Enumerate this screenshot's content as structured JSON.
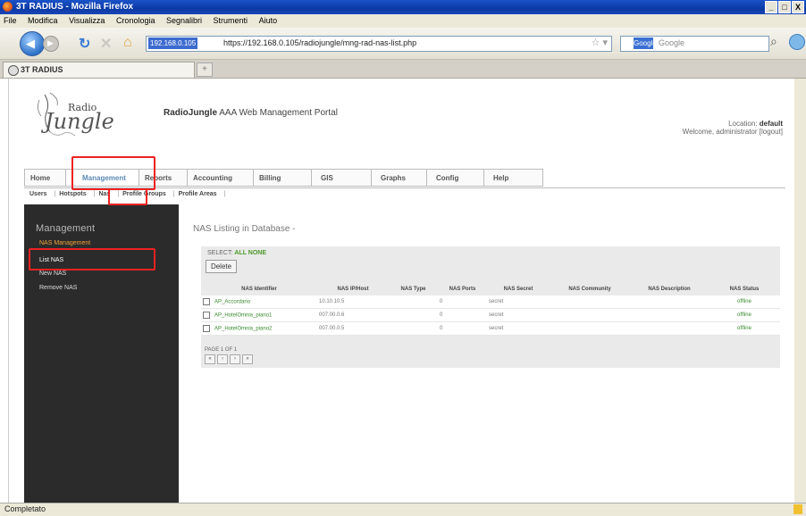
{
  "window": {
    "title": "3T RADIUS - Mozilla Firefox",
    "controls": [
      "_",
      "□",
      "X"
    ]
  },
  "menubar": [
    "File",
    "Modifica",
    "Visualizza",
    "Cronologia",
    "Segnalibri",
    "Strumenti",
    "Aiuto"
  ],
  "navbar": {
    "site_badge": "192.168.0.105",
    "url": "https://192.168.0.105/radiojungle/mng-rad-nas-list.php",
    "search_engine": "Google",
    "search_placeholder": "Google"
  },
  "tab": {
    "title": "3T RADIUS"
  },
  "header": {
    "brand": "RadioJungle",
    "portal": "AAA Web Management Portal",
    "logo_text_top": "Radio",
    "logo_text_bottom": "Jungle",
    "location_label": "Location:",
    "location_value": "default",
    "welcome": "Welcome, administrator [logout]"
  },
  "main_tabs": [
    {
      "label": "Home",
      "active": false
    },
    {
      "label": "Management",
      "active": true
    },
    {
      "label": "Reports",
      "active": false
    },
    {
      "label": "Accounting",
      "active": false
    },
    {
      "label": "Billing",
      "active": false
    },
    {
      "label": "GIS",
      "active": false
    },
    {
      "label": "Graphs",
      "active": false
    },
    {
      "label": "Config",
      "active": false
    },
    {
      "label": "Help",
      "active": false
    }
  ],
  "sub_tabs": [
    "Users",
    "Hotspots",
    "Nas",
    "Profile Groups",
    "Profile Areas"
  ],
  "sidebar": {
    "heading": "Management",
    "section": "NAS Management",
    "items": [
      "List NAS",
      "New NAS",
      "Remove NAS"
    ]
  },
  "content": {
    "title": "NAS Listing in Database -",
    "select_label": "SELECT:",
    "select_value": "ALL NONE",
    "delete_button": "Delete",
    "columns": [
      "NAS Identifier",
      "NAS IP/Host",
      "NAS Type",
      "NAS Ports",
      "NAS Secret",
      "NAS Community",
      "NAS Description",
      "NAS Status"
    ],
    "rows": [
      [
        "AP_Accordano",
        "10.10.10.5",
        "",
        "0",
        "secret",
        "",
        "",
        "offline"
      ],
      [
        "AP_HotelOmnia_piano1",
        "007.00.0.6",
        "",
        "0",
        "secret",
        "",
        "",
        "offline"
      ],
      [
        "AP_HotelOmnia_piano2",
        "007.00.0.5",
        "",
        "0",
        "secret",
        "",
        "",
        "offline"
      ]
    ],
    "pager": "PAGE 1 OF 1",
    "pager_buttons": [
      "«",
      "‹",
      "›",
      "»"
    ]
  },
  "status": {
    "text": "Completato"
  },
  "colors": {
    "titlebar": "#0b3aa6",
    "sidebar": "#2b2b2b",
    "sidebar_section": "#f0a23c",
    "highlight": "#e22222",
    "link_green": "#3a8b2f",
    "active_tab": "#5d8ab5"
  }
}
